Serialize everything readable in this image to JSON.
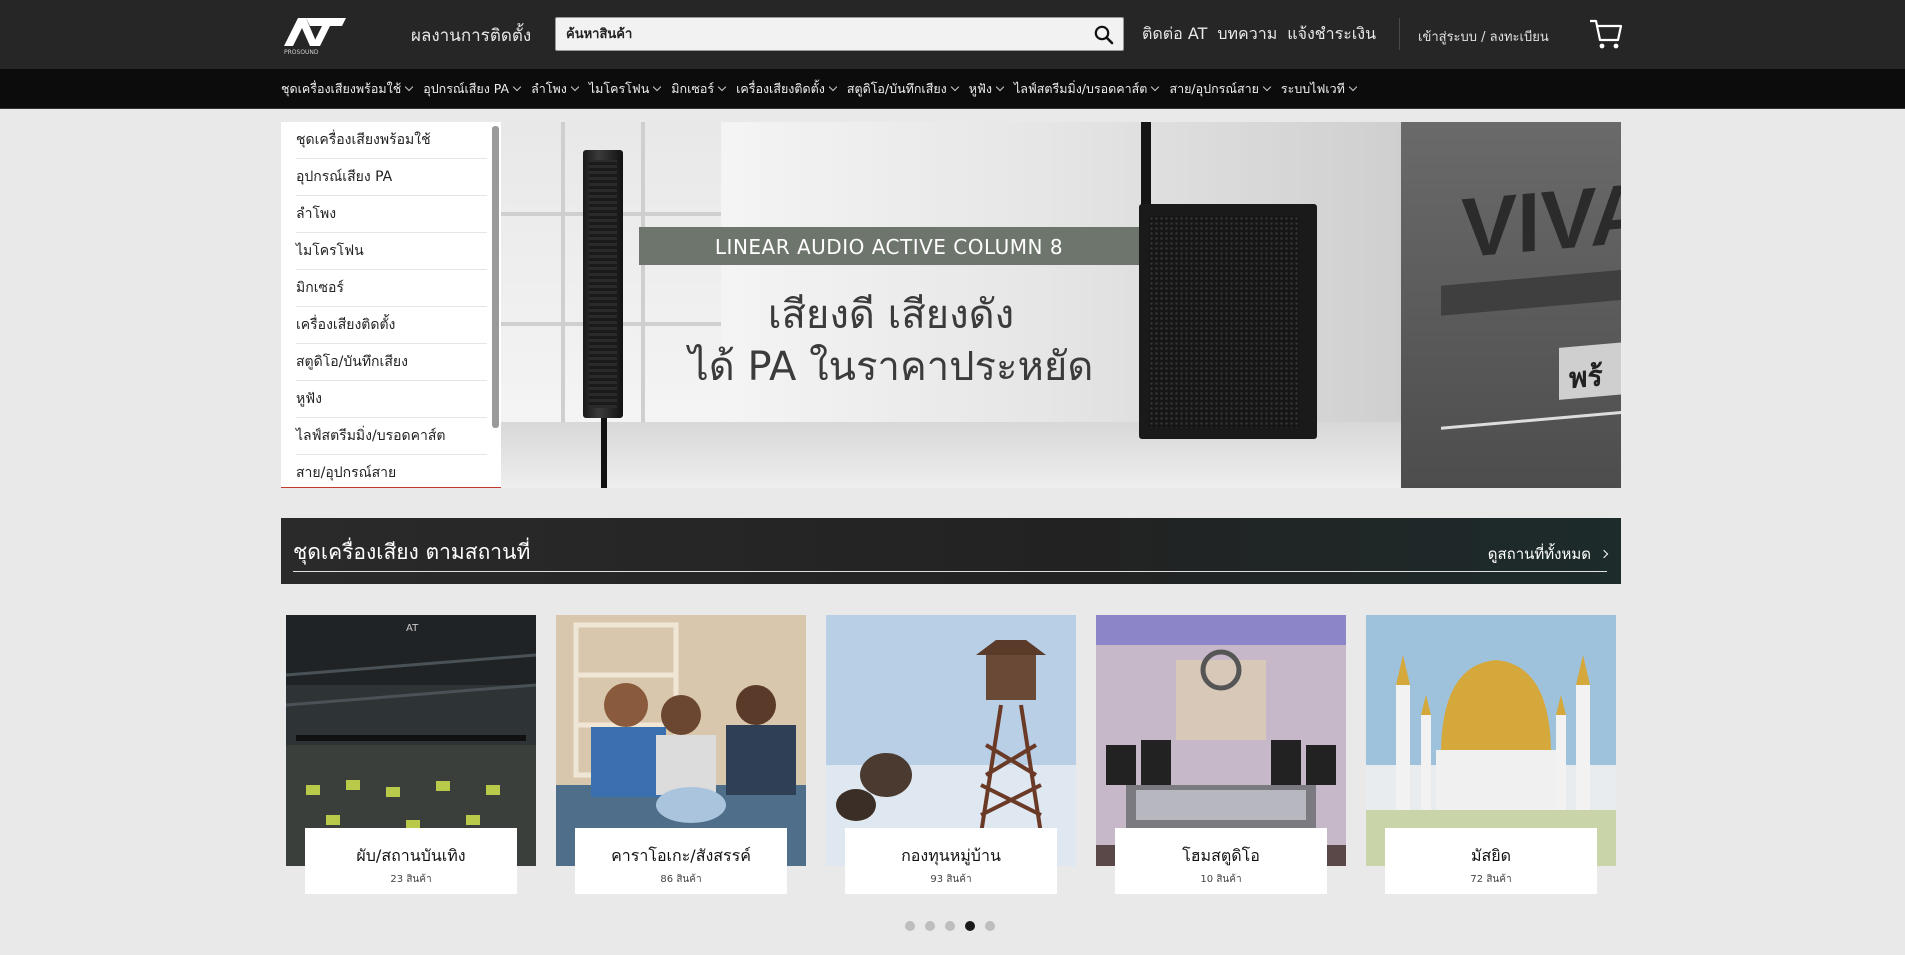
{
  "header": {
    "logo_text": "AT",
    "logo_subtext": "PROSOUND",
    "install_link": "ผลงานการติดตั้ง",
    "search_placeholder": "ค้นหาสินค้า",
    "links": [
      "ติดต่อ AT",
      "บทความ",
      "แจ้งชำระเงิน"
    ],
    "login": "เข้าสู่ระบบ / ลงทะเบียน"
  },
  "nav": {
    "categories": [
      "ชุดเครื่องเสียงพร้อมใช้",
      "อุปกรณ์เสียง PA",
      "ลำโพง",
      "ไมโครโฟน",
      "มิกเซอร์",
      "เครื่องเสียงติดตั้ง",
      "สตูดิโอ/บันทึกเสียง",
      "หูฟัง",
      "ไลฟ์สตรีมมิ่ง/บรอดคาส์ต",
      "สาย/อุปกรณ์สาย",
      "ระบบไฟเวที"
    ]
  },
  "sidemenu": {
    "items": [
      "ชุดเครื่องเสียงพร้อมใช้",
      "อุปกรณ์เสียง PA",
      "ลำโพง",
      "ไมโครโฟน",
      "มิกเซอร์",
      "เครื่องเสียงติดตั้ง",
      "สตูดิโอ/บันทึกเสียง",
      "หูฟัง",
      "ไลฟ์สตรีมมิ่ง/บรอดคาส์ต",
      "สาย/อุปกรณ์สาย"
    ]
  },
  "banner": {
    "product_line": "LINEAR AUDIO ACTIVE COLUMN 8",
    "headline_1": "เสียงดี เสียงดัง",
    "headline_2": "ได้ PA ในราคาประหยัด",
    "next_slide_text": "VIVA",
    "next_slide_tag": "พร้"
  },
  "section": {
    "title": "ชุดเครื่องเสียง ตามสถานที่",
    "view_all": "ดูสถานที่ทั้งหมด"
  },
  "venues": [
    {
      "name": "ผับ/สถานบันเทิง",
      "count": "23 สินค้า",
      "icon": "nightclub"
    },
    {
      "name": "คาราโอเกะ/สังสรรค์",
      "count": "86 สินค้า",
      "icon": "karaoke"
    },
    {
      "name": "กองทุนหมู่บ้าน",
      "count": "93 สินค้า",
      "icon": "village-horn"
    },
    {
      "name": "โฮมสตูดิโอ",
      "count": "10 สินค้า",
      "icon": "home-studio"
    },
    {
      "name": "มัสยิด",
      "count": "72 สินค้า",
      "icon": "mosque"
    }
  ],
  "pager": {
    "total": 5,
    "active_index": 3
  },
  "colors": {
    "header_bg": "#262626",
    "nav_bg": "#0c0c0c",
    "page_bg": "#e9e9e9",
    "sidemenu_underline": "#c0392b"
  }
}
